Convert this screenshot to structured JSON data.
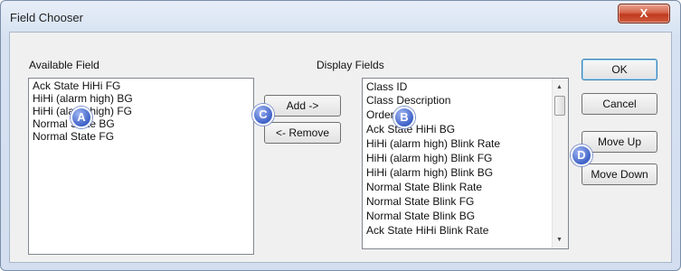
{
  "window": {
    "title": "Field Chooser",
    "close_glyph": "X"
  },
  "available": {
    "label": "Available Field",
    "items": [
      "Ack State HiHi FG",
      "HiHi (alarm high) BG",
      "HiHi (alarm high) FG",
      "Normal State BG",
      "Normal State FG"
    ]
  },
  "display": {
    "label": "Display Fields",
    "items": [
      "Class ID",
      "Class Description",
      "Order",
      "Ack State HiHi BG",
      "HiHi (alarm high) Blink Rate",
      "HiHi (alarm high) Blink FG",
      "HiHi (alarm high) Blink BG",
      "Normal State Blink Rate",
      "Normal State Blink FG",
      "Normal State Blink BG",
      "Ack State HiHi Blink Rate"
    ],
    "scroll_up": "▲",
    "scroll_down": "▼"
  },
  "buttons": {
    "add": "Add ->",
    "remove": "<- Remove",
    "ok": "OK",
    "cancel": "Cancel",
    "move_up": "Move Up",
    "move_down": "Move Down"
  },
  "callouts": {
    "a": "A",
    "b": "B",
    "c": "C",
    "d": "D"
  },
  "colors": {
    "callout": "#3f62c8",
    "close": "#c0391d",
    "default_border": "#3c7fb1"
  }
}
